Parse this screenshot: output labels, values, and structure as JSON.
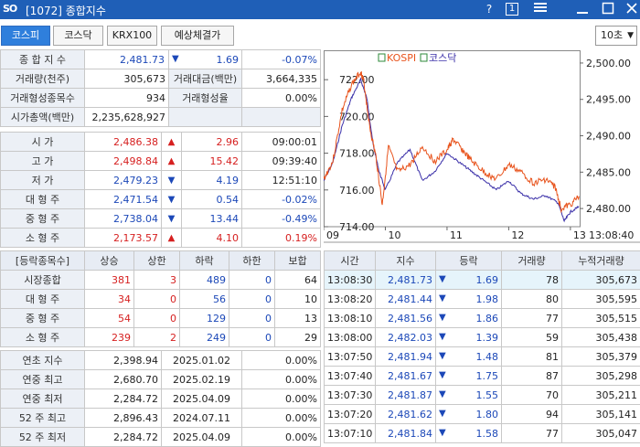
{
  "window": {
    "logo": "SO",
    "title": "[1072] 종합지수",
    "help": "?",
    "badge": "1",
    "menu_icon": "hamburger-icon",
    "minimize_icon": "minimize-icon",
    "maximize_icon": "maximize-icon",
    "close_icon": "close-icon"
  },
  "tabs": [
    {
      "label": "코스피",
      "active": true
    },
    {
      "label": "코스닥"
    },
    {
      "label": "KRX100"
    },
    {
      "label": "예상체결가"
    }
  ],
  "interval": "10초",
  "colors": {
    "up": "#d62020",
    "down": "#1c48b8",
    "title_bar": "#1f5fb7",
    "kospi_line": "#e8531c",
    "kosdaq_line": "#3a2fa8"
  },
  "summary": {
    "index_label": "종 합 지 수",
    "index_value": "2,481.73",
    "index_change": "1.69",
    "index_pct": "-0.07%",
    "volume_label": "거래량(천주)",
    "volume_value": "305,673",
    "amount_label": "거래대금(백만)",
    "amount_value": "3,664,335",
    "formed_count_label": "거래형성종목수",
    "formed_count_value": "934",
    "formed_rate_label": "거래형성율",
    "formed_rate_value": "0.00%",
    "mktcap_label": "시가총액(백만)",
    "mktcap_value": "2,235,628,927"
  },
  "prices": [
    {
      "label": "시 가",
      "value": "2,486.38",
      "dir": "up",
      "change": "2.96",
      "extra": "09:00:01"
    },
    {
      "label": "고 가",
      "value": "2,498.84",
      "dir": "up",
      "change": "15.42",
      "extra": "09:39:40"
    },
    {
      "label": "저 가",
      "value": "2,479.23",
      "dir": "down",
      "change": "4.19",
      "extra": "12:51:10"
    },
    {
      "label": "대 형 주",
      "value": "2,471.54",
      "dir": "down",
      "change": "0.54",
      "extra": "-0.02%"
    },
    {
      "label": "중 형 주",
      "value": "2,738.04",
      "dir": "down",
      "change": "13.44",
      "extra": "-0.49%"
    },
    {
      "label": "소 형 주",
      "value": "2,173.57",
      "dir": "up",
      "change": "4.10",
      "extra": "0.19%"
    }
  ],
  "breadth": {
    "headers": [
      "[등락종목수]",
      "상승",
      "상한",
      "하락",
      "하한",
      "보합"
    ],
    "rows": [
      {
        "label": "시장종합",
        "up": "381",
        "upper": "3",
        "down": "489",
        "lower": "0",
        "flat": "64"
      },
      {
        "label": "대 형 주",
        "up": "34",
        "upper": "0",
        "down": "56",
        "lower": "0",
        "flat": "10"
      },
      {
        "label": "중 형 주",
        "up": "54",
        "upper": "0",
        "down": "129",
        "lower": "0",
        "flat": "13"
      },
      {
        "label": "소 형 주",
        "up": "239",
        "upper": "2",
        "down": "249",
        "lower": "0",
        "flat": "29"
      }
    ]
  },
  "history": [
    {
      "label": "연초 지수",
      "value": "2,398.94",
      "date": "2025.01.02",
      "pct": "0.00%"
    },
    {
      "label": "연중 최고",
      "value": "2,680.70",
      "date": "2025.02.19",
      "pct": "0.00%"
    },
    {
      "label": "연중 최저",
      "value": "2,284.72",
      "date": "2025.04.09",
      "pct": "0.00%"
    },
    {
      "label": "52 주 최고",
      "value": "2,896.43",
      "date": "2024.07.11",
      "pct": "0.00%"
    },
    {
      "label": "52 주 최저",
      "value": "2,284.72",
      "date": "2025.04.09",
      "pct": "0.00%"
    }
  ],
  "trades": {
    "headers": [
      "시간",
      "지수",
      "등락",
      "거래량",
      "누적거래량"
    ],
    "rows": [
      {
        "time": "13:08:30",
        "index": "2,481.73",
        "change": "1.69",
        "volume": "78",
        "cum": "305,673"
      },
      {
        "time": "13:08:20",
        "index": "2,481.44",
        "change": "1.98",
        "volume": "80",
        "cum": "305,595"
      },
      {
        "time": "13:08:10",
        "index": "2,481.56",
        "change": "1.86",
        "volume": "77",
        "cum": "305,515"
      },
      {
        "time": "13:08:00",
        "index": "2,482.03",
        "change": "1.39",
        "volume": "59",
        "cum": "305,438"
      },
      {
        "time": "13:07:50",
        "index": "2,481.94",
        "change": "1.48",
        "volume": "81",
        "cum": "305,379"
      },
      {
        "time": "13:07:40",
        "index": "2,481.67",
        "change": "1.75",
        "volume": "87",
        "cum": "305,298"
      },
      {
        "time": "13:07:30",
        "index": "2,481.87",
        "change": "1.55",
        "volume": "70",
        "cum": "305,211"
      },
      {
        "time": "13:07:20",
        "index": "2,481.62",
        "change": "1.80",
        "volume": "94",
        "cum": "305,141"
      },
      {
        "time": "13:07:10",
        "index": "2,481.84",
        "change": "1.58",
        "volume": "77",
        "cum": "305,047"
      }
    ]
  },
  "chart_data": {
    "type": "line",
    "legend": [
      "KOSPI",
      "코스닥"
    ],
    "x_ticks": [
      "09",
      "10",
      "11",
      "12",
      "13"
    ],
    "x_end_label": "13:08:40",
    "left_axis": {
      "ticks": [
        "722.00",
        "720.00",
        "718.00",
        "716.00",
        "714.00"
      ],
      "range": [
        714,
        723.5
      ]
    },
    "right_axis": {
      "ticks": [
        "2,500.00",
        "2,495.00",
        "2,490.00",
        "2,485.00",
        "2,480.00"
      ],
      "range": [
        2477.5,
        2501.5
      ]
    },
    "series": [
      {
        "name": "KOSPI",
        "axis": "right",
        "x": [
          9.0,
          9.15,
          9.3,
          9.45,
          9.6,
          9.65,
          9.75,
          9.85,
          9.95,
          10.05,
          10.2,
          10.4,
          10.6,
          10.8,
          11.0,
          11.1,
          11.25,
          11.4,
          11.6,
          11.8,
          12.0,
          12.2,
          12.4,
          12.6,
          12.75,
          12.85,
          13.0,
          13.14
        ],
        "y": [
          2484.0,
          2486.5,
          2493.5,
          2497.0,
          2498.8,
          2497.5,
          2491.0,
          2487.0,
          2480.5,
          2488.5,
          2485.0,
          2486.0,
          2488.5,
          2486.5,
          2488.0,
          2489.5,
          2488.0,
          2486.5,
          2485.0,
          2484.0,
          2486.0,
          2485.0,
          2483.5,
          2484.0,
          2483.0,
          2480.0,
          2480.5,
          2481.7
        ]
      },
      {
        "name": "코스닥",
        "axis": "left",
        "x": [
          9.0,
          9.15,
          9.3,
          9.45,
          9.6,
          9.7,
          9.8,
          9.9,
          10.0,
          10.2,
          10.4,
          10.6,
          10.8,
          11.0,
          11.2,
          11.4,
          11.6,
          11.8,
          12.0,
          12.2,
          12.4,
          12.6,
          12.8,
          12.9,
          13.0,
          13.14
        ],
        "y": [
          716.5,
          717.5,
          719.5,
          721.0,
          722.0,
          721.0,
          718.5,
          717.0,
          716.0,
          717.5,
          718.2,
          716.5,
          717.0,
          718.0,
          717.5,
          717.0,
          716.5,
          716.0,
          716.5,
          715.8,
          715.5,
          715.7,
          715.3,
          714.3,
          714.8,
          715.1
        ]
      }
    ]
  }
}
